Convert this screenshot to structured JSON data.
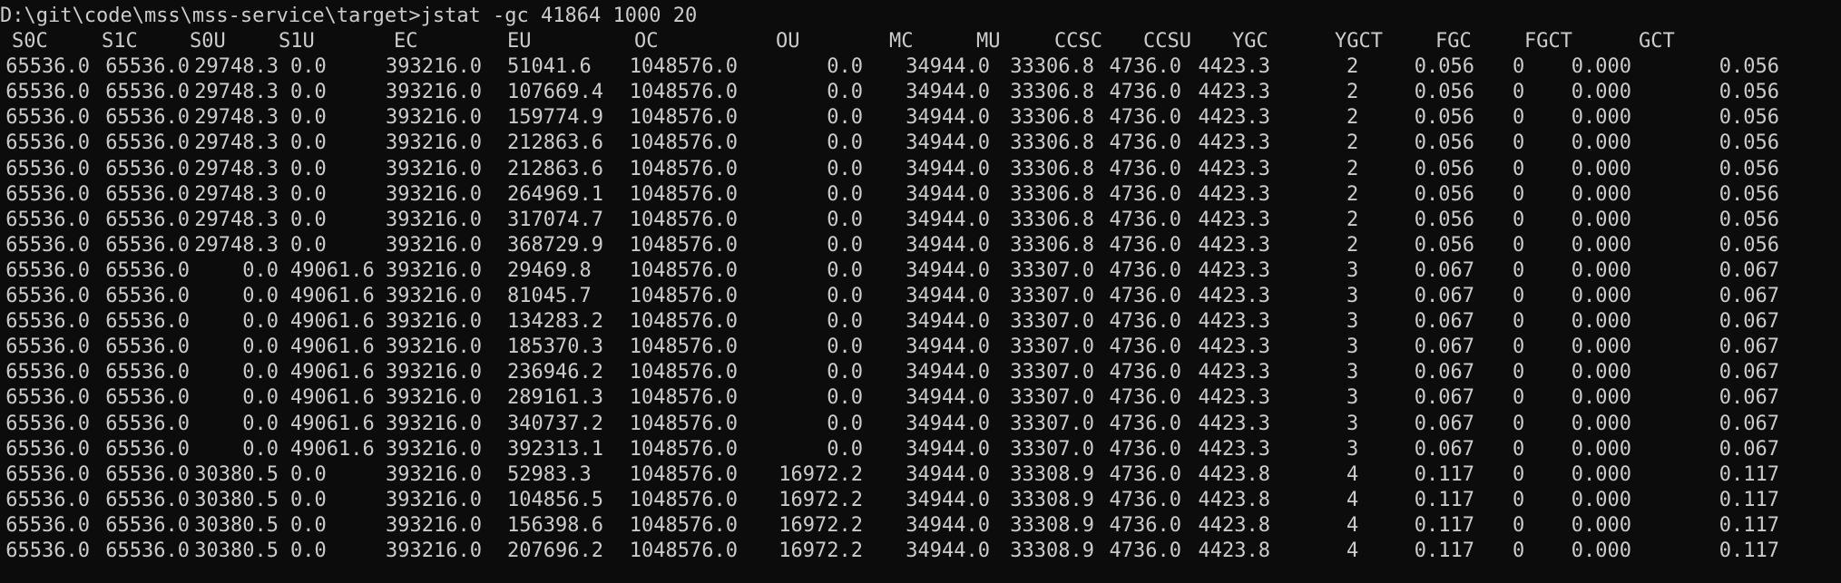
{
  "terminal": {
    "background": "#0c0c0c",
    "foreground": "#cccccc",
    "prompt": "D:\\git\\code\\mss\\mss-service\\target>jstat -gc 41864 1000 20"
  },
  "table": {
    "columns": [
      "S0C",
      "S1C",
      "S0U",
      "S1U",
      "EC",
      "EU",
      "OC",
      "OU",
      "MC",
      "MU",
      "CCSC",
      "CCSU",
      "YGC",
      "YGCT",
      "FGC",
      "FGCT",
      "GCT"
    ],
    "rows": [
      [
        "65536.0",
        "65536.0",
        "29748.3",
        "0.0",
        "393216.0",
        "51041.6",
        "1048576.0",
        "0.0",
        "34944.0",
        "33306.8",
        "4736.0",
        "4423.3",
        "2",
        "0.056",
        "0",
        "0.000",
        "0.056"
      ],
      [
        "65536.0",
        "65536.0",
        "29748.3",
        "0.0",
        "393216.0",
        "107669.4",
        "1048576.0",
        "0.0",
        "34944.0",
        "33306.8",
        "4736.0",
        "4423.3",
        "2",
        "0.056",
        "0",
        "0.000",
        "0.056"
      ],
      [
        "65536.0",
        "65536.0",
        "29748.3",
        "0.0",
        "393216.0",
        "159774.9",
        "1048576.0",
        "0.0",
        "34944.0",
        "33306.8",
        "4736.0",
        "4423.3",
        "2",
        "0.056",
        "0",
        "0.000",
        "0.056"
      ],
      [
        "65536.0",
        "65536.0",
        "29748.3",
        "0.0",
        "393216.0",
        "212863.6",
        "1048576.0",
        "0.0",
        "34944.0",
        "33306.8",
        "4736.0",
        "4423.3",
        "2",
        "0.056",
        "0",
        "0.000",
        "0.056"
      ],
      [
        "65536.0",
        "65536.0",
        "29748.3",
        "0.0",
        "393216.0",
        "212863.6",
        "1048576.0",
        "0.0",
        "34944.0",
        "33306.8",
        "4736.0",
        "4423.3",
        "2",
        "0.056",
        "0",
        "0.000",
        "0.056"
      ],
      [
        "65536.0",
        "65536.0",
        "29748.3",
        "0.0",
        "393216.0",
        "264969.1",
        "1048576.0",
        "0.0",
        "34944.0",
        "33306.8",
        "4736.0",
        "4423.3",
        "2",
        "0.056",
        "0",
        "0.000",
        "0.056"
      ],
      [
        "65536.0",
        "65536.0",
        "29748.3",
        "0.0",
        "393216.0",
        "317074.7",
        "1048576.0",
        "0.0",
        "34944.0",
        "33306.8",
        "4736.0",
        "4423.3",
        "2",
        "0.056",
        "0",
        "0.000",
        "0.056"
      ],
      [
        "65536.0",
        "65536.0",
        "29748.3",
        "0.0",
        "393216.0",
        "368729.9",
        "1048576.0",
        "0.0",
        "34944.0",
        "33306.8",
        "4736.0",
        "4423.3",
        "2",
        "0.056",
        "0",
        "0.000",
        "0.056"
      ],
      [
        "65536.0",
        "65536.0",
        "0.0",
        "49061.6",
        "393216.0",
        "29469.8",
        "1048576.0",
        "0.0",
        "34944.0",
        "33307.0",
        "4736.0",
        "4423.3",
        "3",
        "0.067",
        "0",
        "0.000",
        "0.067"
      ],
      [
        "65536.0",
        "65536.0",
        "0.0",
        "49061.6",
        "393216.0",
        "81045.7",
        "1048576.0",
        "0.0",
        "34944.0",
        "33307.0",
        "4736.0",
        "4423.3",
        "3",
        "0.067",
        "0",
        "0.000",
        "0.067"
      ],
      [
        "65536.0",
        "65536.0",
        "0.0",
        "49061.6",
        "393216.0",
        "134283.2",
        "1048576.0",
        "0.0",
        "34944.0",
        "33307.0",
        "4736.0",
        "4423.3",
        "3",
        "0.067",
        "0",
        "0.000",
        "0.067"
      ],
      [
        "65536.0",
        "65536.0",
        "0.0",
        "49061.6",
        "393216.0",
        "185370.3",
        "1048576.0",
        "0.0",
        "34944.0",
        "33307.0",
        "4736.0",
        "4423.3",
        "3",
        "0.067",
        "0",
        "0.000",
        "0.067"
      ],
      [
        "65536.0",
        "65536.0",
        "0.0",
        "49061.6",
        "393216.0",
        "236946.2",
        "1048576.0",
        "0.0",
        "34944.0",
        "33307.0",
        "4736.0",
        "4423.3",
        "3",
        "0.067",
        "0",
        "0.000",
        "0.067"
      ],
      [
        "65536.0",
        "65536.0",
        "0.0",
        "49061.6",
        "393216.0",
        "289161.3",
        "1048576.0",
        "0.0",
        "34944.0",
        "33307.0",
        "4736.0",
        "4423.3",
        "3",
        "0.067",
        "0",
        "0.000",
        "0.067"
      ],
      [
        "65536.0",
        "65536.0",
        "0.0",
        "49061.6",
        "393216.0",
        "340737.2",
        "1048576.0",
        "0.0",
        "34944.0",
        "33307.0",
        "4736.0",
        "4423.3",
        "3",
        "0.067",
        "0",
        "0.000",
        "0.067"
      ],
      [
        "65536.0",
        "65536.0",
        "0.0",
        "49061.6",
        "393216.0",
        "392313.1",
        "1048576.0",
        "0.0",
        "34944.0",
        "33307.0",
        "4736.0",
        "4423.3",
        "3",
        "0.067",
        "0",
        "0.000",
        "0.067"
      ],
      [
        "65536.0",
        "65536.0",
        "30380.5",
        "0.0",
        "393216.0",
        "52983.3",
        "1048576.0",
        "16972.2",
        "34944.0",
        "33308.9",
        "4736.0",
        "4423.8",
        "4",
        "0.117",
        "0",
        "0.000",
        "0.117"
      ],
      [
        "65536.0",
        "65536.0",
        "30380.5",
        "0.0",
        "393216.0",
        "104856.5",
        "1048576.0",
        "16972.2",
        "34944.0",
        "33308.9",
        "4736.0",
        "4423.8",
        "4",
        "0.117",
        "0",
        "0.000",
        "0.117"
      ],
      [
        "65536.0",
        "65536.0",
        "30380.5",
        "0.0",
        "393216.0",
        "156398.6",
        "1048576.0",
        "16972.2",
        "34944.0",
        "33308.9",
        "4736.0",
        "4423.8",
        "4",
        "0.117",
        "0",
        "0.000",
        "0.117"
      ],
      [
        "65536.0",
        "65536.0",
        "30380.5",
        "0.0",
        "393216.0",
        "207696.2",
        "1048576.0",
        "16972.2",
        "34944.0",
        "33308.9",
        "4736.0",
        "4423.8",
        "4",
        "0.117",
        "0",
        "0.000",
        "0.117"
      ]
    ]
  }
}
